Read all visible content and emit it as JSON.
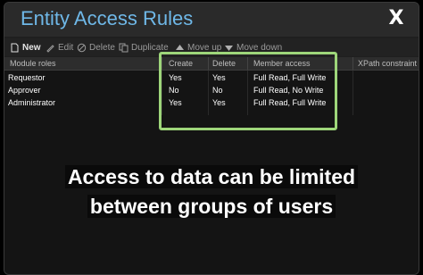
{
  "window": {
    "title": "Entity Access Rules",
    "close_label": "X"
  },
  "toolbar": {
    "new_label": "New",
    "edit_label": "Edit",
    "delete_label": "Delete",
    "duplicate_label": "Duplicate",
    "move_up_label": "Move up",
    "move_down_label": "Move down"
  },
  "grid": {
    "columns": [
      "Module roles",
      "Create",
      "Delete",
      "Member access",
      "XPath constraint"
    ],
    "rows": [
      {
        "role": "Requestor",
        "create": "Yes",
        "delete": "Yes",
        "member_access": "Full Read, Full Write",
        "xpath": ""
      },
      {
        "role": "Approver",
        "create": "No",
        "delete": "No",
        "member_access": "Full Read, No Write",
        "xpath": ""
      },
      {
        "role": "Administrator",
        "create": "Yes",
        "delete": "Yes",
        "member_access": "Full Read, Full Write",
        "xpath": ""
      }
    ]
  },
  "caption": {
    "line1": "Access to data can be limited",
    "line2": "between groups of users"
  },
  "colors": {
    "title": "#6fb8e8",
    "highlight": "#9ed67a"
  }
}
